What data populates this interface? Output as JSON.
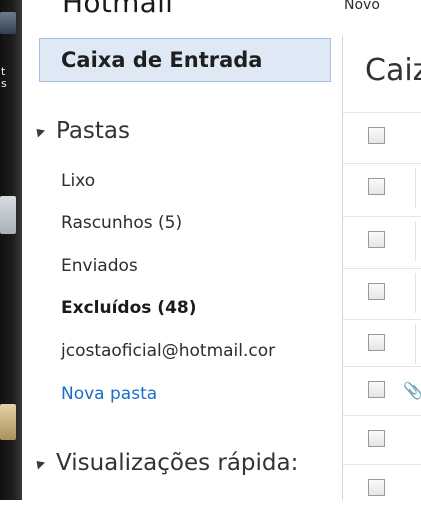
{
  "header": {
    "title": "Hotmail",
    "new_label": "Novo"
  },
  "left_strip": {
    "text": "t\ns"
  },
  "sidebar": {
    "inbox_label": "Caixa de Entrada",
    "folders_section": "Pastas",
    "folders": [
      {
        "label": "Lixo",
        "bold": false
      },
      {
        "label": "Rascunhos (5)",
        "bold": false
      },
      {
        "label": "Enviados",
        "bold": false
      },
      {
        "label": "Excluídos (48)",
        "bold": true
      },
      {
        "label": "jcostaoficial@hotmail.cor",
        "bold": false
      }
    ],
    "new_folder_label": "Nova pasta",
    "quick_views_section": "Visualizações rápida:"
  },
  "main": {
    "title": "Caiz"
  },
  "colors": {
    "selected_bg": "#dfe9f5",
    "link": "#1b6ec2"
  }
}
